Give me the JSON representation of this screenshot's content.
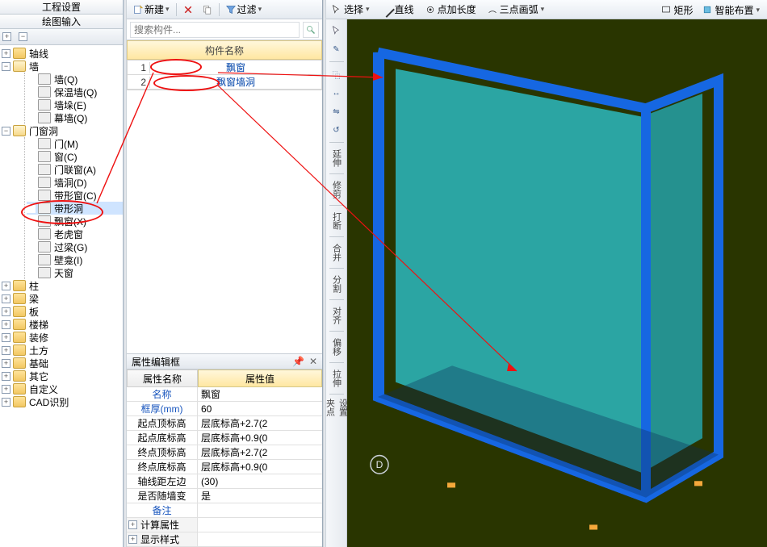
{
  "left": {
    "tab1": "工程设置",
    "tab2": "绘图输入",
    "tree": {
      "axis": "轴线",
      "wall": "墙",
      "wall_children": [
        "墙(Q)",
        "保温墙(Q)",
        "墙垛(E)",
        "幕墙(Q)"
      ],
      "opening": "门窗洞",
      "opening_children": [
        "门(M)",
        "窗(C)",
        "门联窗(A)",
        "墙洞(D)",
        "带形窗(C)",
        "带形洞",
        "飘窗(X)",
        "老虎窗",
        "过梁(G)",
        "壁龛(I)",
        "天窗"
      ],
      "cats": [
        "柱",
        "梁",
        "板",
        "楼梯",
        "装修",
        "土方",
        "基础",
        "其它",
        "自定义",
        "CAD识别"
      ]
    }
  },
  "mid": {
    "new": "新建",
    "filter": "过滤",
    "search_ph": "搜索构件...",
    "col_name": "构件名称",
    "rows": [
      {
        "n": "1",
        "v": "飘窗"
      },
      {
        "n": "2",
        "v": "飘窗墙洞"
      }
    ],
    "prop_title": "属性编辑框",
    "ph_name": "属性名称",
    "ph_val": "属性值",
    "props": [
      {
        "k": "名称",
        "v": "飘窗",
        "blue": true
      },
      {
        "k": "框厚(mm)",
        "v": "60",
        "blue": true
      },
      {
        "k": "起点顶标高",
        "v": "层底标高+2.7(2"
      },
      {
        "k": "起点底标高",
        "v": "层底标高+0.9(0"
      },
      {
        "k": "终点顶标高",
        "v": "层底标高+2.7(2"
      },
      {
        "k": "终点底标高",
        "v": "层底标高+0.9(0"
      },
      {
        "k": "轴线距左边",
        "v": "(30)"
      },
      {
        "k": "是否随墙变",
        "v": "是"
      },
      {
        "k": "备注",
        "v": "",
        "blue": true
      }
    ],
    "groups": [
      "计算属性",
      "显示样式"
    ]
  },
  "right": {
    "select": "选择",
    "line": "直线",
    "point": "点加长度",
    "arc3": "三点画弧",
    "rect": "矩形",
    "smart": "智能布置",
    "vtools_label": [
      "延伸",
      "修剪",
      "打断",
      "合并",
      "分割",
      "对齐",
      "偏移",
      "拉伸",
      "设置夹点"
    ],
    "marker": "D"
  }
}
